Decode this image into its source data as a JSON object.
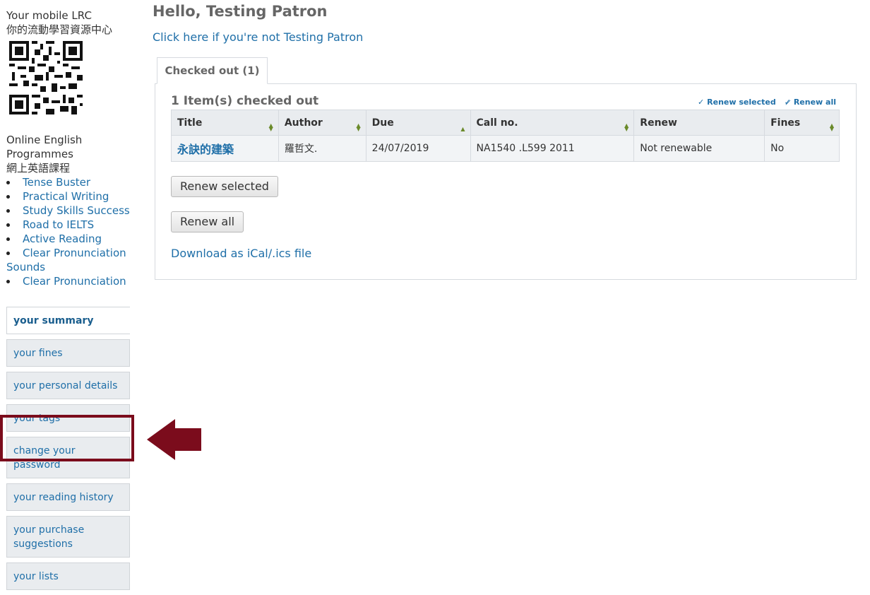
{
  "sidebar": {
    "mobile_title": "Your mobile LRC",
    "mobile_title_zh": "你的流動學習資源中心",
    "programmes_title": "Online English Programmes",
    "programmes_title_zh": "網上英語課程",
    "programmes": [
      "Tense Buster",
      "Practical Writing",
      "Study Skills Success",
      "Road to IELTS",
      "Active Reading",
      "Clear Pronunciation Sounds",
      "Clear Pronunciation"
    ],
    "menu": [
      "your summary",
      "your fines",
      "your personal details",
      "your tags",
      "change your password",
      "your reading history",
      "your purchase suggestions",
      "your lists"
    ],
    "highlight_color": "#7b0c1c"
  },
  "main": {
    "greeting": "Hello, Testing Patron",
    "not_you_link": "Click here if you're not Testing Patron",
    "tab_label": "Checked out (1)",
    "count_heading": "1 Item(s) checked out",
    "renew_selected_link": "Renew selected",
    "renew_all_link": "Renew all",
    "table": {
      "headers": [
        "Title",
        "Author",
        "Due",
        "Call no.",
        "Renew",
        "Fines"
      ],
      "rows": [
        {
          "title": "永訣的建築",
          "author": "羅哲文.",
          "due": "24/07/2019",
          "call_no": "NA1540 .L599 2011",
          "renew": "Not renewable",
          "fines": "No"
        }
      ]
    },
    "renew_selected_button": "Renew selected",
    "renew_all_button": "Renew all",
    "ical_link": "Download as iCal/.ics file"
  },
  "colors": {
    "link": "#1f6fa8",
    "heading_gray": "#666666",
    "table_header_bg": "#e9ecef",
    "menu_bg": "#e9ecef"
  }
}
